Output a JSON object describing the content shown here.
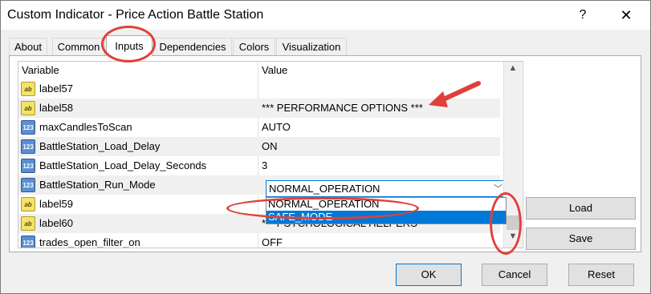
{
  "window": {
    "title": "Custom Indicator - Price Action Battle Station",
    "help_label": "?",
    "close_label": "✕"
  },
  "tabs": [
    {
      "label": "About"
    },
    {
      "label": "Common"
    },
    {
      "label": "Inputs"
    },
    {
      "label": "Dependencies"
    },
    {
      "label": "Colors"
    },
    {
      "label": "Visualization"
    }
  ],
  "active_tab": "Inputs",
  "grid": {
    "columns": {
      "variable": "Variable",
      "value": "Value"
    },
    "rows": [
      {
        "icon": "ab",
        "icon_name": "string-type-icon",
        "name": "label57",
        "value": ""
      },
      {
        "icon": "ab",
        "icon_name": "string-type-icon",
        "name": "label58",
        "value": "*** PERFORMANCE OPTIONS ***"
      },
      {
        "icon": "123",
        "icon_name": "number-type-icon",
        "name": "maxCandlesToScan",
        "value": "AUTO"
      },
      {
        "icon": "123",
        "icon_name": "number-type-icon",
        "name": "BattleStation_Load_Delay",
        "value": "ON"
      },
      {
        "icon": "123",
        "icon_name": "number-type-icon",
        "name": "BattleStation_Load_Delay_Seconds",
        "value": "3"
      },
      {
        "icon": "123",
        "icon_name": "number-type-icon",
        "name": "BattleStation_Run_Mode",
        "value": ""
      },
      {
        "icon": "ab",
        "icon_name": "string-type-icon",
        "name": "label59",
        "value": ""
      },
      {
        "icon": "ab",
        "icon_name": "string-type-icon",
        "name": "label60",
        "value": "*** PSYCHOLOGICAL HELPERS ***"
      },
      {
        "icon": "123",
        "icon_name": "number-type-icon",
        "name": "trades_open_filter_on",
        "value": "OFF"
      }
    ],
    "run_mode_select": {
      "selected": "NORMAL_OPERATION",
      "options": [
        "NORMAL_OPERATION",
        "SAFE_MODE"
      ],
      "highlighted": "SAFE_MODE"
    },
    "scroll_up_icon": "▲",
    "scroll_down_icon": "▼"
  },
  "side_buttons": {
    "load": "Load",
    "save": "Save"
  },
  "footer_buttons": {
    "ok": "OK",
    "cancel": "Cancel",
    "reset": "Reset"
  },
  "colors": {
    "annotation": "#e0403a",
    "select_highlight": "#0078d7"
  }
}
